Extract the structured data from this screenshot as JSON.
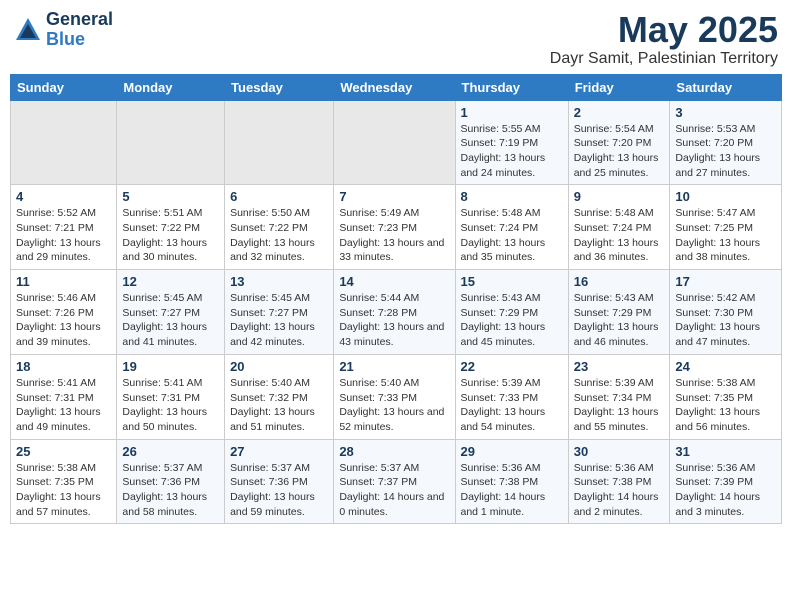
{
  "header": {
    "logo_line1": "General",
    "logo_line2": "Blue",
    "title": "May 2025",
    "subtitle": "Dayr Samit, Palestinian Territory"
  },
  "days_of_week": [
    "Sunday",
    "Monday",
    "Tuesday",
    "Wednesday",
    "Thursday",
    "Friday",
    "Saturday"
  ],
  "weeks": [
    [
      {
        "day": "",
        "empty": true
      },
      {
        "day": "",
        "empty": true
      },
      {
        "day": "",
        "empty": true
      },
      {
        "day": "",
        "empty": true
      },
      {
        "day": "1",
        "sunrise": "5:55 AM",
        "sunset": "7:19 PM",
        "daylight": "13 hours and 24 minutes."
      },
      {
        "day": "2",
        "sunrise": "5:54 AM",
        "sunset": "7:20 PM",
        "daylight": "13 hours and 25 minutes."
      },
      {
        "day": "3",
        "sunrise": "5:53 AM",
        "sunset": "7:20 PM",
        "daylight": "13 hours and 27 minutes."
      }
    ],
    [
      {
        "day": "4",
        "sunrise": "5:52 AM",
        "sunset": "7:21 PM",
        "daylight": "13 hours and 29 minutes."
      },
      {
        "day": "5",
        "sunrise": "5:51 AM",
        "sunset": "7:22 PM",
        "daylight": "13 hours and 30 minutes."
      },
      {
        "day": "6",
        "sunrise": "5:50 AM",
        "sunset": "7:22 PM",
        "daylight": "13 hours and 32 minutes."
      },
      {
        "day": "7",
        "sunrise": "5:49 AM",
        "sunset": "7:23 PM",
        "daylight": "13 hours and 33 minutes."
      },
      {
        "day": "8",
        "sunrise": "5:48 AM",
        "sunset": "7:24 PM",
        "daylight": "13 hours and 35 minutes."
      },
      {
        "day": "9",
        "sunrise": "5:48 AM",
        "sunset": "7:24 PM",
        "daylight": "13 hours and 36 minutes."
      },
      {
        "day": "10",
        "sunrise": "5:47 AM",
        "sunset": "7:25 PM",
        "daylight": "13 hours and 38 minutes."
      }
    ],
    [
      {
        "day": "11",
        "sunrise": "5:46 AM",
        "sunset": "7:26 PM",
        "daylight": "13 hours and 39 minutes."
      },
      {
        "day": "12",
        "sunrise": "5:45 AM",
        "sunset": "7:27 PM",
        "daylight": "13 hours and 41 minutes."
      },
      {
        "day": "13",
        "sunrise": "5:45 AM",
        "sunset": "7:27 PM",
        "daylight": "13 hours and 42 minutes."
      },
      {
        "day": "14",
        "sunrise": "5:44 AM",
        "sunset": "7:28 PM",
        "daylight": "13 hours and 43 minutes."
      },
      {
        "day": "15",
        "sunrise": "5:43 AM",
        "sunset": "7:29 PM",
        "daylight": "13 hours and 45 minutes."
      },
      {
        "day": "16",
        "sunrise": "5:43 AM",
        "sunset": "7:29 PM",
        "daylight": "13 hours and 46 minutes."
      },
      {
        "day": "17",
        "sunrise": "5:42 AM",
        "sunset": "7:30 PM",
        "daylight": "13 hours and 47 minutes."
      }
    ],
    [
      {
        "day": "18",
        "sunrise": "5:41 AM",
        "sunset": "7:31 PM",
        "daylight": "13 hours and 49 minutes."
      },
      {
        "day": "19",
        "sunrise": "5:41 AM",
        "sunset": "7:31 PM",
        "daylight": "13 hours and 50 minutes."
      },
      {
        "day": "20",
        "sunrise": "5:40 AM",
        "sunset": "7:32 PM",
        "daylight": "13 hours and 51 minutes."
      },
      {
        "day": "21",
        "sunrise": "5:40 AM",
        "sunset": "7:33 PM",
        "daylight": "13 hours and 52 minutes."
      },
      {
        "day": "22",
        "sunrise": "5:39 AM",
        "sunset": "7:33 PM",
        "daylight": "13 hours and 54 minutes."
      },
      {
        "day": "23",
        "sunrise": "5:39 AM",
        "sunset": "7:34 PM",
        "daylight": "13 hours and 55 minutes."
      },
      {
        "day": "24",
        "sunrise": "5:38 AM",
        "sunset": "7:35 PM",
        "daylight": "13 hours and 56 minutes."
      }
    ],
    [
      {
        "day": "25",
        "sunrise": "5:38 AM",
        "sunset": "7:35 PM",
        "daylight": "13 hours and 57 minutes."
      },
      {
        "day": "26",
        "sunrise": "5:37 AM",
        "sunset": "7:36 PM",
        "daylight": "13 hours and 58 minutes."
      },
      {
        "day": "27",
        "sunrise": "5:37 AM",
        "sunset": "7:36 PM",
        "daylight": "13 hours and 59 minutes."
      },
      {
        "day": "28",
        "sunrise": "5:37 AM",
        "sunset": "7:37 PM",
        "daylight": "14 hours and 0 minutes."
      },
      {
        "day": "29",
        "sunrise": "5:36 AM",
        "sunset": "7:38 PM",
        "daylight": "14 hours and 1 minute."
      },
      {
        "day": "30",
        "sunrise": "5:36 AM",
        "sunset": "7:38 PM",
        "daylight": "14 hours and 2 minutes."
      },
      {
        "day": "31",
        "sunrise": "5:36 AM",
        "sunset": "7:39 PM",
        "daylight": "14 hours and 3 minutes."
      }
    ]
  ]
}
